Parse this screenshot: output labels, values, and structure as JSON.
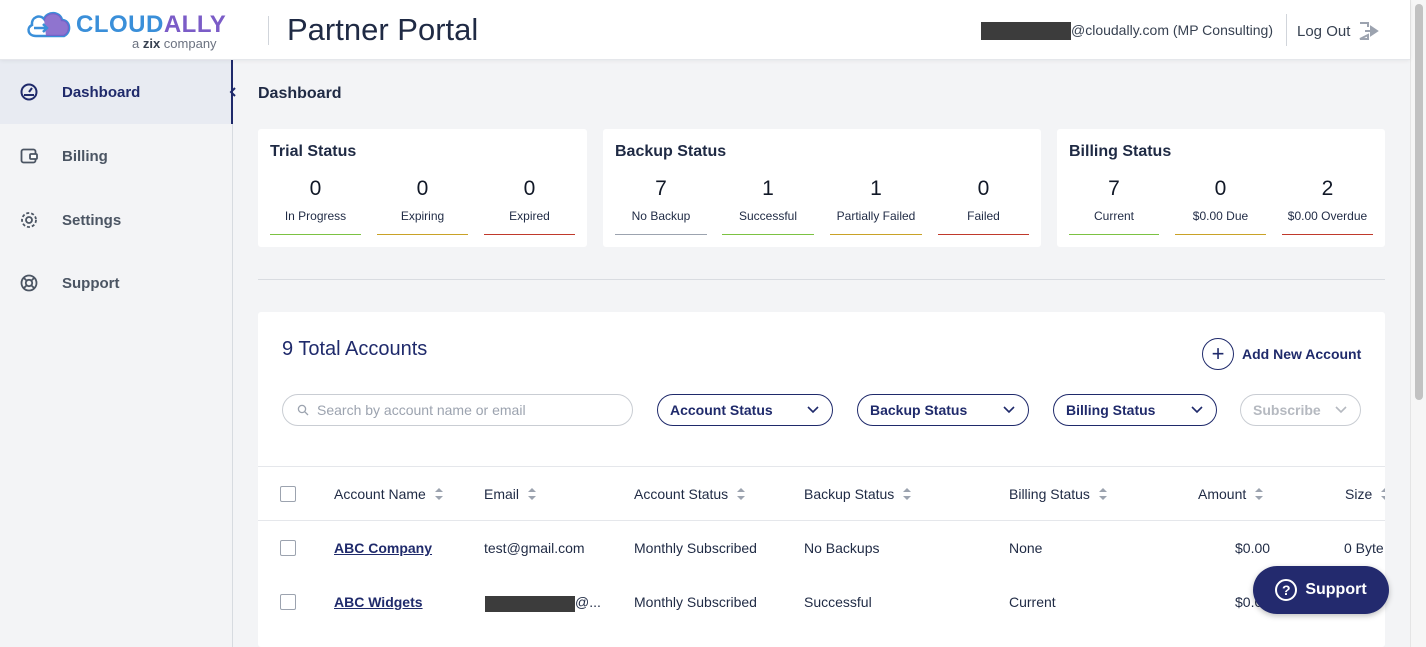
{
  "header": {
    "logo_part1": "CLOUD",
    "logo_part2": "ALLY",
    "logo_sub_prefix": "a ",
    "logo_sub_brand": "zix",
    "logo_sub_suffix": " company",
    "title": "Partner Portal",
    "user": "@cloudally.com (MP Consulting)",
    "logout": "Log Out"
  },
  "sidebar": {
    "items": [
      {
        "label": "Dashboard",
        "icon": "gauge-icon"
      },
      {
        "label": "Billing",
        "icon": "wallet-icon"
      },
      {
        "label": "Settings",
        "icon": "gear-icon"
      },
      {
        "label": "Support",
        "icon": "lifebuoy-icon"
      }
    ]
  },
  "breadcrumb": "Dashboard",
  "cards": {
    "trial": {
      "title": "Trial Status",
      "stats": [
        {
          "value": "0",
          "label": "In Progress",
          "color": "#7cc242"
        },
        {
          "value": "0",
          "label": "Expiring",
          "color": "#c9a227"
        },
        {
          "value": "0",
          "label": "Expired",
          "color": "#c0392b"
        }
      ]
    },
    "backup": {
      "title": "Backup Status",
      "stats": [
        {
          "value": "7",
          "label": "No Backup",
          "color": "#9ca3af"
        },
        {
          "value": "1",
          "label": "Successful",
          "color": "#7cc242"
        },
        {
          "value": "1",
          "label": "Partially Failed",
          "color": "#c9a227"
        },
        {
          "value": "0",
          "label": "Failed",
          "color": "#c0392b"
        }
      ]
    },
    "billing": {
      "title": "Billing Status",
      "stats": [
        {
          "value": "7",
          "label": "Current",
          "color": "#7cc242"
        },
        {
          "value": "0",
          "label": "$0.00 Due",
          "color": "#c9a227"
        },
        {
          "value": "2",
          "label": "$0.00 Overdue",
          "color": "#c0392b"
        }
      ]
    }
  },
  "accounts": {
    "total": "9 Total Accounts",
    "add_label": "Add New Account",
    "search_placeholder": "Search by account name or email",
    "filters": {
      "account_status": "Account Status",
      "backup_status": "Backup Status",
      "billing_status": "Billing Status",
      "subscribe": "Subscribe"
    },
    "columns": [
      "Account Name",
      "Email",
      "Account Status",
      "Backup Status",
      "Billing Status",
      "Amount",
      "Size"
    ],
    "rows": [
      {
        "name": "ABC Company",
        "email": "test@gmail.com",
        "account_status": "Monthly Subscribed",
        "backup_status": "No Backups",
        "billing_status": "None",
        "amount": "$0.00",
        "size": "0 Byte"
      },
      {
        "name": "ABC Widgets",
        "email": "@...",
        "account_status": "Monthly Subscribed",
        "backup_status": "Successful",
        "billing_status": "Current",
        "amount": "$0.00",
        "size": ""
      }
    ]
  },
  "support_button": "Support"
}
